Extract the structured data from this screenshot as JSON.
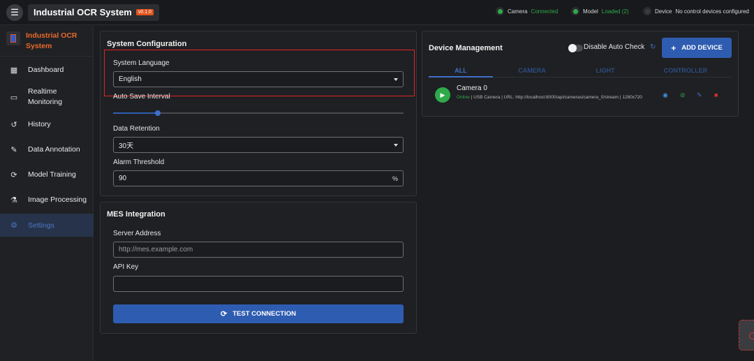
{
  "header": {
    "menu_icon": "menu-icon",
    "title": "Industrial OCR System",
    "version": "v0.1.0",
    "status": [
      {
        "label": "Camera",
        "value": "Connected",
        "color": "#2eaa4a"
      },
      {
        "label": "Model",
        "value": "Loaded (2)",
        "color": "#2eaa4a"
      },
      {
        "label": "Device",
        "value": "No control devices configured",
        "color": "#3a3b40"
      }
    ]
  },
  "sidebar": {
    "brand": "Industrial OCR System",
    "items": [
      {
        "label": "Dashboard",
        "icon": "dashboard-icon"
      },
      {
        "label": "Realtime Monitoring",
        "icon": "monitor-icon"
      },
      {
        "label": "History",
        "icon": "history-icon"
      },
      {
        "label": "Data Annotation",
        "icon": "pencil-icon"
      },
      {
        "label": "Model Training",
        "icon": "training-icon"
      },
      {
        "label": "Image Processing",
        "icon": "flask-icon"
      },
      {
        "label": "Settings",
        "icon": "gear-icon",
        "active": true
      }
    ]
  },
  "system_config": {
    "title": "System Configuration",
    "language_label": "System Language",
    "language_value": "English",
    "autosave_label": "Auto Save Interval",
    "autosave_level": 0.15,
    "retention_label": "Data Retention",
    "retention_value": "30天",
    "alarm_label": "Alarm Threshold",
    "alarm_value": "90",
    "alarm_suffix": "%"
  },
  "mes": {
    "title": "MES Integration",
    "server_label": "Server Address",
    "server_placeholder": "http://mes.example.com",
    "api_label": "API Key",
    "api_value": "",
    "test_button": "TEST CONNECTION"
  },
  "devices": {
    "title": "Device Management",
    "disable_check_label": "Disable Auto Check",
    "add_button": "ADD DEVICE",
    "tabs": [
      "ALL",
      "CAMERA",
      "LIGHT",
      "CONTROLLER"
    ],
    "active_tab": "ALL",
    "list": [
      {
        "name": "Camera 0",
        "status": "Online",
        "details": " | USB Camera | URL: http://localhost:8000/api/cameras/camera_0/stream | 1280x720"
      }
    ]
  },
  "colors": {
    "accent": "#2e5cb0",
    "brand": "#ea6a2e",
    "online": "#2eaa4a",
    "highlight": "#e02424"
  }
}
